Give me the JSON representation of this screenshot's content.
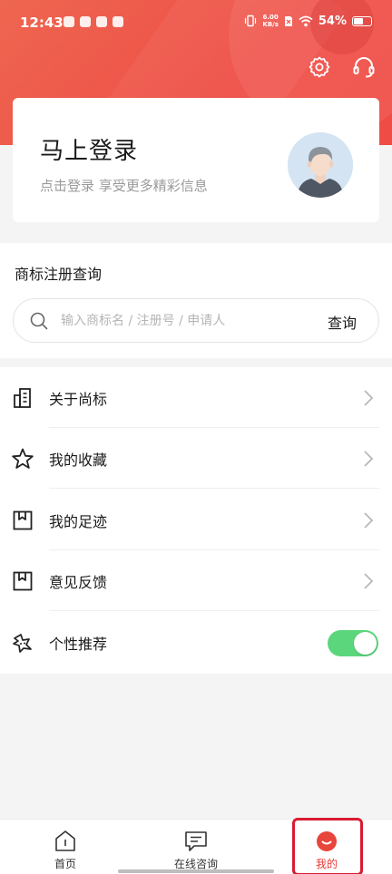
{
  "status_bar": {
    "time": "12:43",
    "net_speed_value": "6.00",
    "net_speed_unit": "KB/s",
    "battery": "54%"
  },
  "header": {
    "settings_icon": "gear-icon",
    "service_icon": "headset-icon"
  },
  "login_card": {
    "title": "马上登录",
    "subtitle": "点击登录 享受更多精彩信息",
    "avatar_icon": "user-avatar"
  },
  "trademark_search": {
    "title": "商标注册查询",
    "placeholder": "输入商标名 / 注册号 / 申请人",
    "button_label": "查询"
  },
  "menu": {
    "items": [
      {
        "label": "关于尚标",
        "icon": "building-icon"
      },
      {
        "label": "我的收藏",
        "icon": "star-icon"
      },
      {
        "label": "我的足迹",
        "icon": "bookmark-icon"
      },
      {
        "label": "意见反馈",
        "icon": "feedback-icon"
      },
      {
        "label": "个性推荐",
        "icon": "sparkle-icon",
        "toggle_on": true
      }
    ]
  },
  "tab_bar": {
    "tabs": [
      {
        "label": "首页",
        "icon": "home-icon"
      },
      {
        "label": "在线咨询",
        "icon": "chat-icon"
      },
      {
        "label": "我的",
        "icon": "profile-icon",
        "active": true
      }
    ]
  },
  "colors": {
    "brand_red": "#ef4f46",
    "toggle_green": "#5cd67c",
    "active_tab": "#e53935"
  }
}
